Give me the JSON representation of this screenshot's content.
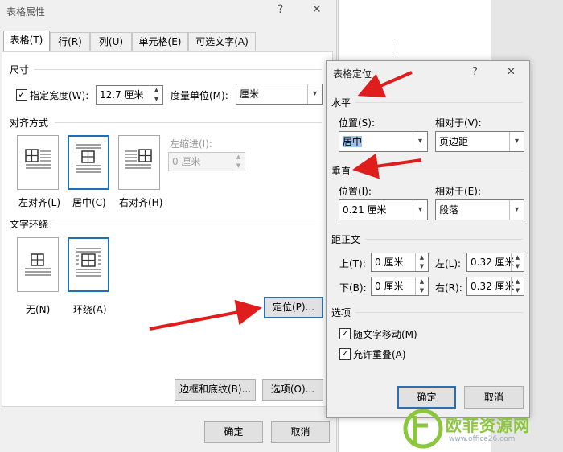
{
  "main_dialog": {
    "title": "表格属性",
    "help_icon": "?",
    "close_icon": "✕",
    "tabs": [
      {
        "label": "表格(T)"
      },
      {
        "label": "行(R)"
      },
      {
        "label": "列(U)"
      },
      {
        "label": "单元格(E)"
      },
      {
        "label": "可选文字(A)"
      }
    ],
    "size": {
      "heading": "尺寸",
      "preferred_width_label": "指定宽度(W):",
      "preferred_width_value": "12.7 厘米",
      "measure_label": "度量单位(M):",
      "measure_value": "厘米"
    },
    "alignment": {
      "heading": "对齐方式",
      "options": [
        {
          "label": "左对齐(L)"
        },
        {
          "label": "居中(C)"
        },
        {
          "label": "右对齐(H)"
        }
      ],
      "indent_label": "左缩进(I):",
      "indent_value": "0 厘米"
    },
    "wrapping": {
      "heading": "文字环绕",
      "options": [
        {
          "label": "无(N)"
        },
        {
          "label": "环绕(A)"
        }
      ]
    },
    "positioning_button": "定位(P)...",
    "borders_button": "边框和底纹(B)...",
    "options_button": "选项(O)...",
    "ok": "确定",
    "cancel": "取消"
  },
  "positioning_dialog": {
    "title": "表格定位",
    "help_icon": "?",
    "close_icon": "✕",
    "horizontal": {
      "heading": "水平",
      "position_label": "位置(S):",
      "position_value": "居中",
      "relative_label": "相对于(V):",
      "relative_value": "页边距"
    },
    "vertical": {
      "heading": "垂直",
      "position_label": "位置(I):",
      "position_value": "0.21 厘米",
      "relative_label": "相对于(E):",
      "relative_value": "段落"
    },
    "distance": {
      "heading": "距正文",
      "top_label": "上(T):",
      "top_value": "0 厘米",
      "left_label": "左(L):",
      "left_value": "0.32 厘米",
      "bottom_label": "下(B):",
      "bottom_value": "0 厘米",
      "right_label": "右(R):",
      "right_value": "0.32 厘米"
    },
    "options": {
      "heading": "选项",
      "move_with_text": "随文字移动(M)",
      "allow_overlap": "允许重叠(A)"
    },
    "ok": "确定",
    "cancel": "取消"
  },
  "watermark": {
    "text": "欧菲资源网",
    "url": "www.office26.com"
  }
}
